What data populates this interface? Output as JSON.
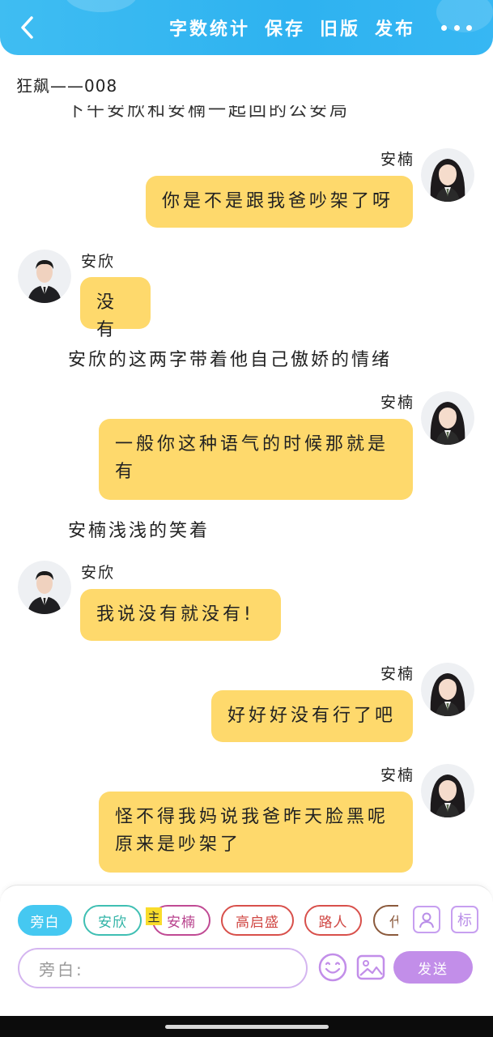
{
  "header": {
    "actions": [
      "字数统计",
      "保存",
      "旧版",
      "发布"
    ]
  },
  "story": {
    "title": "狂飙——008",
    "cut_line": "下午安欣和安楠一起回的公安局"
  },
  "messages": [
    {
      "kind": "right",
      "name": "安楠",
      "text_lines": [
        "你是不是跟我爸吵架了呀"
      ]
    },
    {
      "kind": "left",
      "name": "安欣",
      "text_lines": [
        "没有"
      ]
    },
    {
      "kind": "narration",
      "text": "安欣的这两字带着他自己傲娇的情绪"
    },
    {
      "kind": "right",
      "name": "安楠",
      "text_lines": [
        "一般你这种语气的时候那就是",
        "有"
      ]
    },
    {
      "kind": "narration",
      "text": "安楠浅浅的笑着"
    },
    {
      "kind": "left",
      "name": "安欣",
      "text_lines": [
        "我说没有就没有!"
      ]
    },
    {
      "kind": "right",
      "name": "安楠",
      "text_lines": [
        "好好好没有行了吧"
      ]
    },
    {
      "kind": "right",
      "name": "安楠",
      "text_lines": [
        "怪不得我妈说我爸昨天脸黑呢",
        "原来是吵架了"
      ]
    }
  ],
  "composer": {
    "roles": [
      {
        "label": "旁白",
        "border": "#45c8f1",
        "fill": "#45c8f1",
        "text_color": "#ffffff"
      },
      {
        "label": "安欣",
        "border": "#3fbfb3",
        "fill": "#ffffff",
        "text_color": "#2fb3a6"
      },
      {
        "label": "安楠",
        "border": "#c04a94",
        "fill": "#ffffff",
        "text_color": "#b8428d"
      },
      {
        "label": "高启盛",
        "border": "#d8504b",
        "fill": "#ffffff",
        "text_color": "#d04844"
      },
      {
        "label": "路人",
        "border": "#d8504b",
        "fill": "#ffffff",
        "text_color": "#d04844"
      },
      {
        "label": "代",
        "border": "#8b5a3c",
        "fill": "#ffffff",
        "text_color": "#8b5a3c"
      }
    ],
    "main_tag": "主",
    "tag_icon_label": "标",
    "input_value": "旁白:",
    "send_label": "发送"
  },
  "colors": {
    "header": "#2eb2f0",
    "bubble": "#fed96c",
    "send": "#c28ee9"
  },
  "icons": [
    "back-arrow-icon",
    "more-dots-icon",
    "portrait-icon",
    "tag-icon",
    "emoji-icon",
    "image-icon"
  ]
}
